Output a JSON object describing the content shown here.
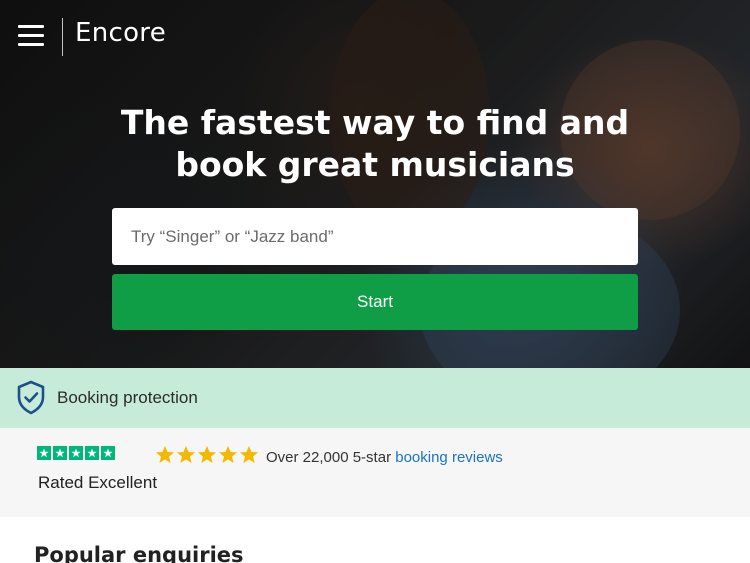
{
  "header": {
    "logo_text": "Encore",
    "menu_icon": "hamburger-menu-icon"
  },
  "hero": {
    "headline_line1": "The fastest way to find and",
    "headline_line2": "book great musicians",
    "search_placeholder": "Try “Singer” or “Jazz band”",
    "search_value": "",
    "start_label": "Start"
  },
  "protection": {
    "icon": "shield-check-icon",
    "label": "Booking protection"
  },
  "ratings": {
    "trustpilot_star_count": 5,
    "rated_label": "Rated Excellent",
    "gold_star_count": 5,
    "reviews_text": "Over 22,000 5-star",
    "reviews_link": "booking reviews"
  },
  "sections": {
    "popular_title": "Popular enquiries"
  },
  "colors": {
    "primary_green": "#0f9d45",
    "protection_bg": "#c6ecd9",
    "trustpilot_green": "#00b67a",
    "star_gold": "#f5b800",
    "link_blue": "#1a73c4"
  }
}
